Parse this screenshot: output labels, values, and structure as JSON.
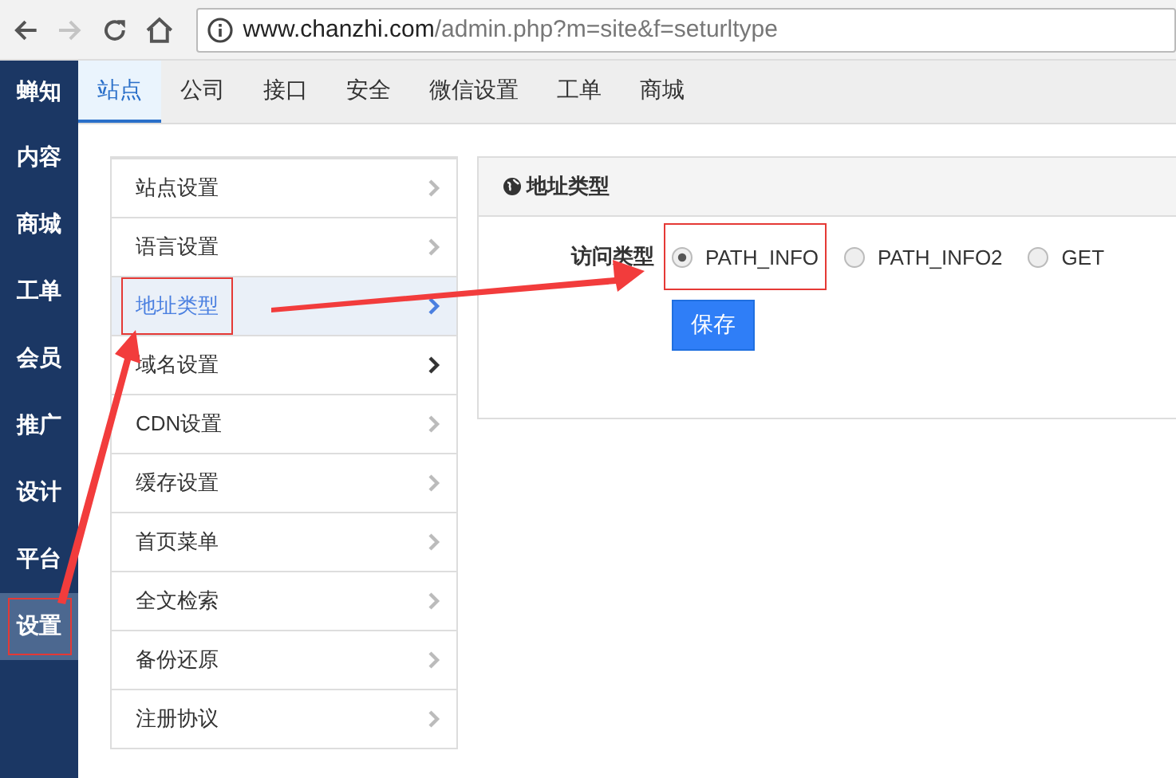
{
  "browser": {
    "url_host": "www.chanzhi.com",
    "url_path": "/admin.php?m=site&f=seturltype",
    "forward_disabled": true
  },
  "sidebar": {
    "brand": "蝉知",
    "items": [
      {
        "label": "内容",
        "selected": false,
        "highlighted": false
      },
      {
        "label": "商城",
        "selected": false,
        "highlighted": false
      },
      {
        "label": "工单",
        "selected": false,
        "highlighted": false
      },
      {
        "label": "会员",
        "selected": false,
        "highlighted": false
      },
      {
        "label": "推广",
        "selected": false,
        "highlighted": false
      },
      {
        "label": "设计",
        "selected": false,
        "highlighted": false
      },
      {
        "label": "平台",
        "selected": false,
        "highlighted": false
      },
      {
        "label": "设置",
        "selected": true,
        "highlighted": true
      }
    ]
  },
  "tabs": [
    {
      "label": "站点",
      "selected": true
    },
    {
      "label": "公司",
      "selected": false
    },
    {
      "label": "接口",
      "selected": false
    },
    {
      "label": "安全",
      "selected": false
    },
    {
      "label": "微信设置",
      "selected": false
    },
    {
      "label": "工单",
      "selected": false
    },
    {
      "label": "商城",
      "selected": false
    }
  ],
  "settings_menu": [
    {
      "label": "站点设置",
      "selected": false,
      "hovered": false,
      "highlighted": false
    },
    {
      "label": "语言设置",
      "selected": false,
      "hovered": false,
      "highlighted": false
    },
    {
      "label": "地址类型",
      "selected": true,
      "hovered": false,
      "highlighted": true
    },
    {
      "label": "域名设置",
      "selected": false,
      "hovered": true,
      "highlighted": false
    },
    {
      "label": "CDN设置",
      "selected": false,
      "hovered": false,
      "highlighted": false
    },
    {
      "label": "缓存设置",
      "selected": false,
      "hovered": false,
      "highlighted": false
    },
    {
      "label": "首页菜单",
      "selected": false,
      "hovered": false,
      "highlighted": false
    },
    {
      "label": "全文检索",
      "selected": false,
      "hovered": false,
      "highlighted": false
    },
    {
      "label": "备份还原",
      "selected": false,
      "hovered": false,
      "highlighted": false
    },
    {
      "label": "注册协议",
      "selected": false,
      "hovered": false,
      "highlighted": false
    }
  ],
  "panel": {
    "title": "地址类型",
    "field_label": "访问类型",
    "options": [
      {
        "label": "PATH_INFO",
        "selected": true,
        "highlighted": true
      },
      {
        "label": "PATH_INFO2",
        "selected": false,
        "highlighted": false
      },
      {
        "label": "GET",
        "selected": false,
        "highlighted": false
      }
    ],
    "save_button": "保存"
  }
}
